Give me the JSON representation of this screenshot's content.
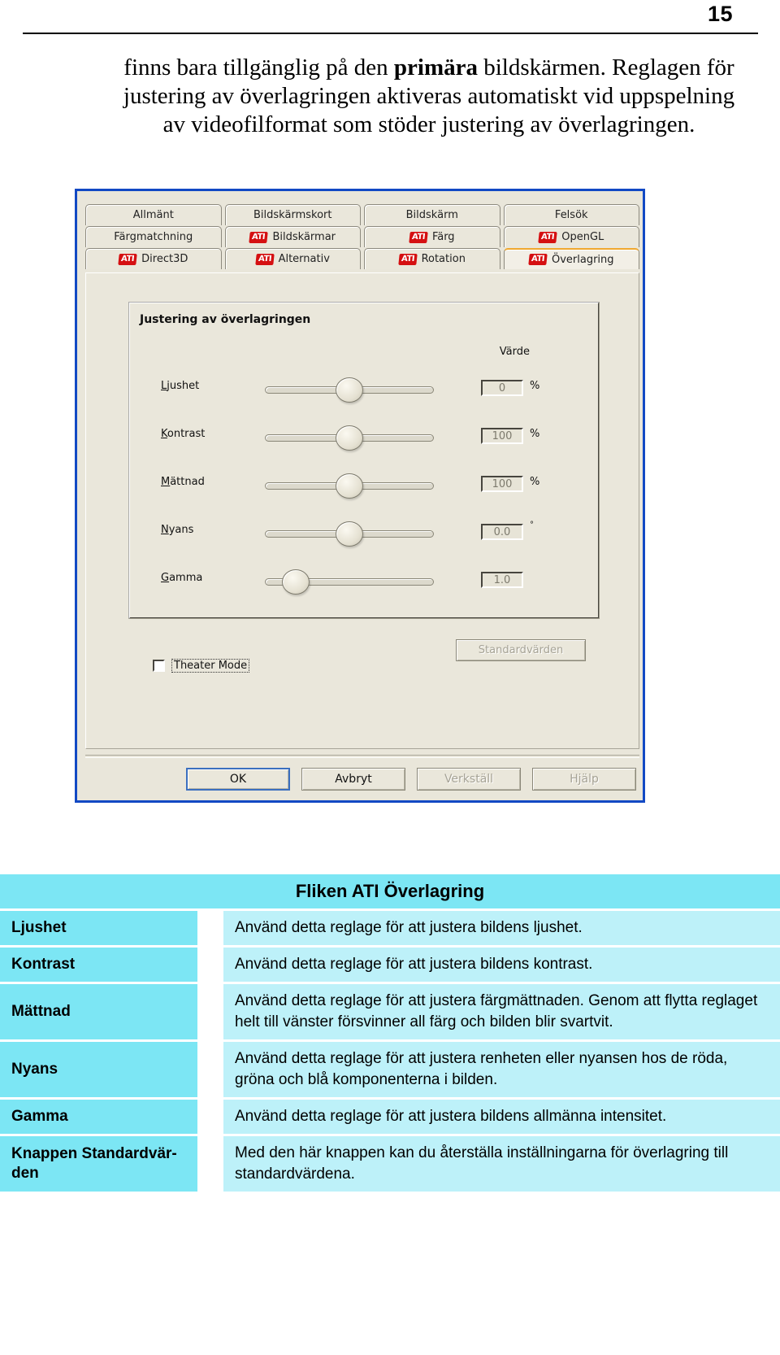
{
  "page": {
    "number": "15",
    "paragraph_line1_pre": "finns bara tillgänglig på den ",
    "paragraph_line1_bold": "primära",
    "paragraph_line1_post": " bildskärmen.",
    "paragraph_rest": "Reglagen för justering av överlagringen aktiveras automatiskt vid uppspelning av videofilformat som stöder justering av överlagringen."
  },
  "dialog": {
    "tab_rows": [
      [
        {
          "label": "Allmänt",
          "ati": false,
          "selected": false
        },
        {
          "label": "Bildskärmskort",
          "ati": false,
          "selected": false
        },
        {
          "label": "Bildskärm",
          "ati": false,
          "selected": false
        },
        {
          "label": "Felsök",
          "ati": false,
          "selected": false
        }
      ],
      [
        {
          "label": "Färgmatchning",
          "ati": false,
          "selected": false
        },
        {
          "label": "Bildskärmar",
          "ati": true,
          "selected": false
        },
        {
          "label": "Färg",
          "ati": true,
          "selected": false
        },
        {
          "label": "OpenGL",
          "ati": true,
          "selected": false
        }
      ],
      [
        {
          "label": "Direct3D",
          "ati": true,
          "selected": false
        },
        {
          "label": "Alternativ",
          "ati": true,
          "selected": false
        },
        {
          "label": "Rotation",
          "ati": true,
          "selected": false
        },
        {
          "label": "Överlagring",
          "ati": true,
          "selected": true
        }
      ]
    ],
    "ati_logo_text": "ATI",
    "group_title": "Justering av överlagringen",
    "value_column_header": "Värde",
    "sliders": [
      {
        "label_accel": "L",
        "label_rest": "jushet",
        "value": "0",
        "unit": "%",
        "thumb_pct": 50
      },
      {
        "label_accel": "K",
        "label_rest": "ontrast",
        "value": "100",
        "unit": "%",
        "thumb_pct": 50
      },
      {
        "label_accel": "M",
        "label_rest": "ättnad",
        "value": "100",
        "unit": "%",
        "thumb_pct": 50
      },
      {
        "label_accel": "N",
        "label_rest": "yans",
        "value": "0.0",
        "unit": "°",
        "thumb_pct": 50
      },
      {
        "label_accel": "G",
        "label_rest": "amma",
        "value": "1.0",
        "unit": "",
        "thumb_pct": 12
      }
    ],
    "reset_button_label": "Standardvärden",
    "theater_mode_label": "Theater Mode",
    "theater_mode_checked": false,
    "buttons": [
      {
        "label": "OK",
        "state": "default"
      },
      {
        "label": "Avbryt",
        "state": "normal"
      },
      {
        "label": "Verkställ",
        "state": "disabled"
      },
      {
        "label": "Hjälp",
        "state": "disabled"
      }
    ]
  },
  "table": {
    "header": "Fliken ATI Överlagring",
    "rows": [
      {
        "term": "Ljushet",
        "desc": "Använd detta reglage för att justera bildens ljushet."
      },
      {
        "term": "Kontrast",
        "desc": "Använd detta reglage för att justera bildens kontrast."
      },
      {
        "term": "Mättnad",
        "desc": "Använd detta reglage för att justera färgmättnaden. Genom att flytta reglaget helt till vänster försvinner all färg och bilden blir svartvit."
      },
      {
        "term": "Nyans",
        "desc": "Använd detta reglage för att justera renheten eller nyansen hos de röda, gröna och blå komponenterna i bilden."
      },
      {
        "term": "Gamma",
        "desc": "Använd detta reglage för att justera bildens allmänna intensitet."
      },
      {
        "term": "Knappen Standardvär-\nden",
        "desc": "Med den här knappen kan du återställa inställningarna för överlagring till standardvärdena."
      }
    ]
  },
  "colors": {
    "table_header_bg": "#7ce6f4",
    "table_term_bg": "#7ce6f4",
    "table_desc_bg": "#bdf1f9",
    "dialog_border": "#1249c4",
    "selected_tab_accent": "#f0a830",
    "ati_red": "#d51012"
  }
}
